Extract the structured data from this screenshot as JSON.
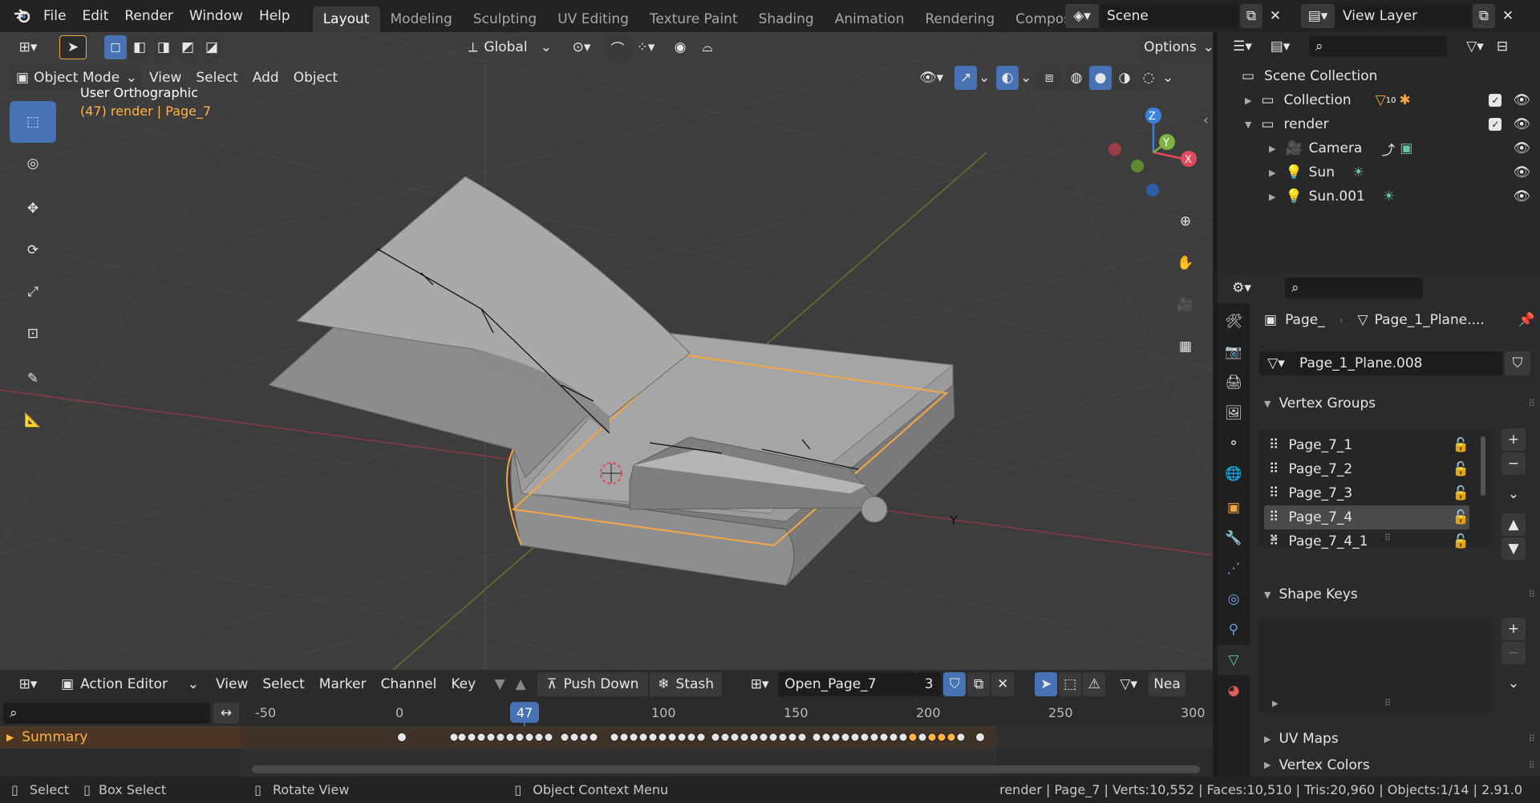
{
  "topbar": {
    "menus": [
      "File",
      "Edit",
      "Render",
      "Window",
      "Help"
    ],
    "workspaces": [
      "Layout",
      "Modeling",
      "Sculpting",
      "UV Editing",
      "Texture Paint",
      "Shading",
      "Animation",
      "Rendering",
      "Compos"
    ],
    "active_workspace": "Layout",
    "scene": "Scene",
    "view_layer": "View Layer"
  },
  "viewport": {
    "transform_orientation": "Global",
    "options_label": "Options",
    "mode": "Object Mode",
    "menus": [
      "View",
      "Select",
      "Add",
      "Object"
    ],
    "view_name": "User Orthographic",
    "view_info": "(47) render | Page_7",
    "gizmo": {
      "z": "Z",
      "y": "Y",
      "x": "X"
    },
    "axis_label_y": "Y"
  },
  "action_editor": {
    "editor_type": "Action Editor",
    "menus": [
      "View",
      "Select",
      "Marker",
      "Channel",
      "Key"
    ],
    "push_down": "Push Down",
    "stash": "Stash",
    "action_name": "Open_Page_7",
    "users": "3",
    "near_label": "Nea",
    "ruler": [
      "-50",
      "0",
      "50",
      "100",
      "150",
      "200",
      "250",
      "300"
    ],
    "current_frame": "47",
    "channel": "Summary"
  },
  "outliner": {
    "root": "Scene Collection",
    "items": [
      {
        "label": "Collection",
        "badge": "10"
      },
      {
        "label": "render"
      },
      {
        "label": "Camera"
      },
      {
        "label": "Sun"
      },
      {
        "label": "Sun.001"
      }
    ]
  },
  "properties": {
    "breadcrumb_object": "Page_",
    "breadcrumb_data": "Page_1_Plane....",
    "mesh_name": "Page_1_Plane.008",
    "vertex_groups_title": "Vertex Groups",
    "vertex_groups": [
      "Page_7_1",
      "Page_7_2",
      "Page_7_3",
      "Page_7_4",
      "Page_7_4_1"
    ],
    "selected_group": "Page_7_4",
    "shape_keys_title": "Shape Keys",
    "uv_maps_title": "UV Maps",
    "vertex_colors_title": "Vertex Colors"
  },
  "statusbar": {
    "select": "Select",
    "box_select": "Box Select",
    "rotate_view": "Rotate View",
    "context_menu": "Object Context Menu",
    "stats": "render | Page_7 | Verts:10,552 | Faces:10,510 | Tris:20,960 | Objects:1/14 | 2.91.0"
  },
  "colors": {
    "accent": "#4772b3",
    "selection_orange": "#f5a742",
    "frame_orange": "#ffb347",
    "x_axis": "#e04a5a",
    "y_axis": "#7cb342",
    "z_axis": "#3b82e0"
  }
}
